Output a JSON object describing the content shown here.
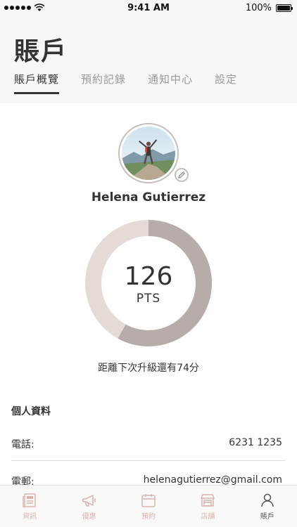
{
  "status_bar": {
    "time": "9:41 AM",
    "battery": "100%"
  },
  "header": {
    "title": "賬戶",
    "tabs": [
      {
        "label": "賬戶概覽",
        "active": true
      },
      {
        "label": "預約記錄",
        "active": false
      },
      {
        "label": "通知中心",
        "active": false
      },
      {
        "label": "設定",
        "active": false
      }
    ]
  },
  "profile": {
    "name": "Helena Gutierrez"
  },
  "points": {
    "value": "126",
    "unit": "PTS",
    "progress": 0.58
  },
  "upgrade_note": "距離下次升級還有74分",
  "personal_info": {
    "title": "個人資料",
    "rows": [
      {
        "label": "電話:",
        "value": "6231 1235"
      },
      {
        "label": "電郵:",
        "value": "helenagutierrez@gmail.com"
      }
    ]
  },
  "tabbar": {
    "items": [
      {
        "label": "資訊",
        "icon": "news-icon",
        "active": false
      },
      {
        "label": "優惠",
        "icon": "megaphone-icon",
        "active": false
      },
      {
        "label": "預約",
        "icon": "calendar-icon",
        "active": false
      },
      {
        "label": "店舖",
        "icon": "store-icon",
        "active": false
      },
      {
        "label": "賬戶",
        "icon": "person-icon",
        "active": true
      }
    ]
  },
  "colors": {
    "ring_track": "#e4dbd7",
    "ring_fill": "#b6adaa",
    "tab_inactive": "#d9b4ad",
    "tab_active": "#555555"
  }
}
